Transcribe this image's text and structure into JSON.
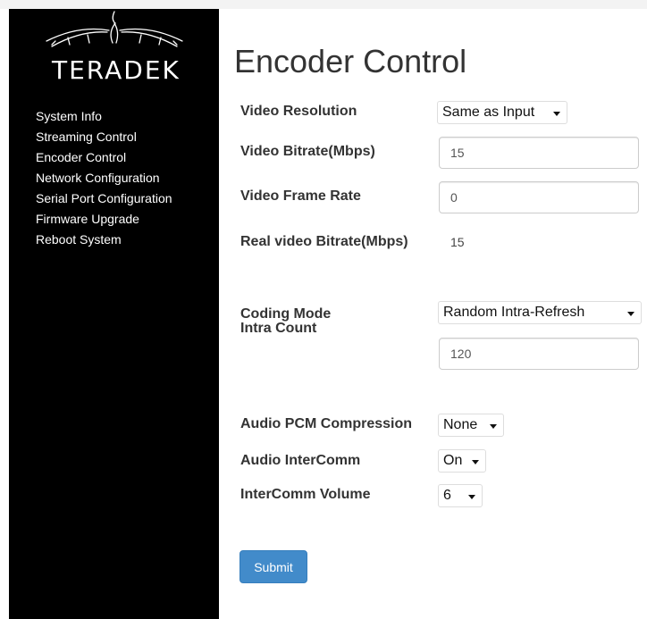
{
  "brand": {
    "logo_text": "TERADEK"
  },
  "sidebar": {
    "items": [
      {
        "label": "System Info"
      },
      {
        "label": "Streaming Control"
      },
      {
        "label": "Encoder Control"
      },
      {
        "label": "Network Configuration"
      },
      {
        "label": "Serial Port Configuration"
      },
      {
        "label": "Firmware Upgrade"
      },
      {
        "label": "Reboot System"
      }
    ]
  },
  "page": {
    "title": "Encoder Control"
  },
  "form": {
    "video_resolution": {
      "label": "Video Resolution",
      "value": "Same as Input"
    },
    "video_bitrate": {
      "label": "Video Bitrate(Mbps)",
      "value": "15"
    },
    "video_frame_rate": {
      "label": "Video Frame Rate",
      "value": "0"
    },
    "real_video_bitrate": {
      "label": "Real video Bitrate(Mbps)",
      "value": "15"
    },
    "coding_mode": {
      "label": "Coding Mode",
      "value": "Random Intra-Refresh"
    },
    "intra_count": {
      "label": "Intra Count",
      "value": "120"
    },
    "audio_pcm_compression": {
      "label": "Audio PCM Compression",
      "value": "None"
    },
    "audio_intercomm": {
      "label": "Audio InterComm",
      "value": "On"
    },
    "intercomm_volume": {
      "label": "InterComm Volume",
      "value": "6"
    },
    "submit_label": "Submit"
  },
  "colors": {
    "sidebar_bg": "#000000",
    "primary_button": "#428bca",
    "heading_text": "#333333"
  }
}
